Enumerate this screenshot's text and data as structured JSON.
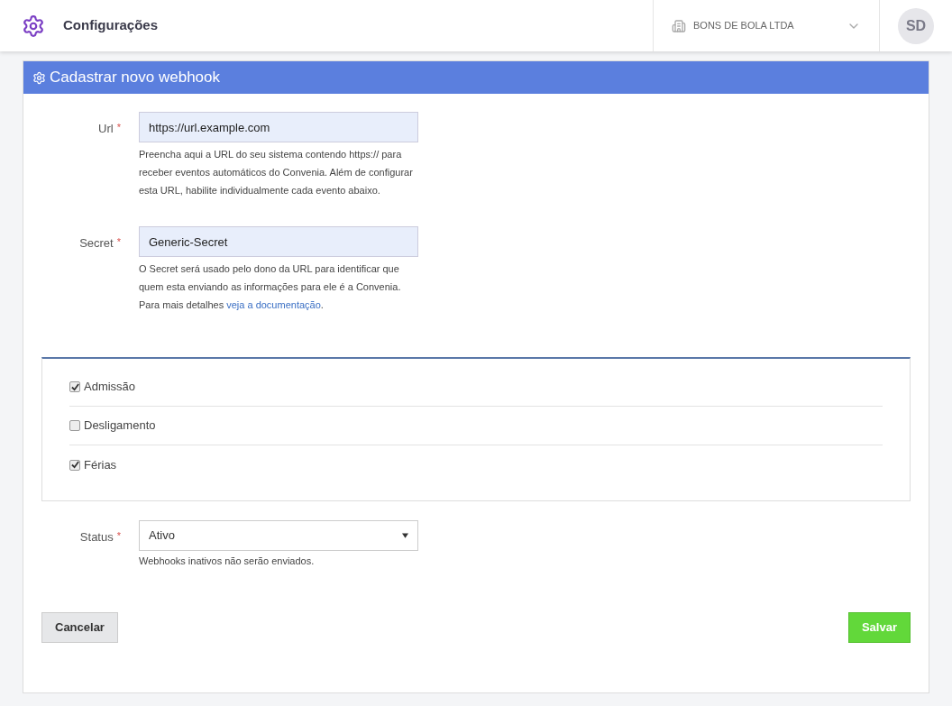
{
  "header": {
    "title": "Configurações",
    "company": "BONS DE BOLA LTDA",
    "avatar": "SD"
  },
  "card": {
    "title": "Cadastrar novo webhook",
    "fields": [
      {
        "label": "Url",
        "required_mark": "*",
        "value": "https://url.example.com",
        "help": {
          "text": "Preencha aqui a URL do seu sistema contendo https:// para receber eventos automáticos do Convenia. Além de configurar esta URL, habilite individualmente cada evento abaixo."
        }
      },
      {
        "label": "Secret",
        "required_mark": "*",
        "value": "Generic-Secret",
        "help": {
          "text": "O Secret será usado pelo dono da URL para identificar que quem esta enviando as informações para ele é a Convenia. Para mais detalhes ",
          "link": "veja a documentação",
          "after": "."
        }
      }
    ],
    "events": [
      {
        "label": "Admissão",
        "checked": true
      },
      {
        "label": "Desligamento",
        "checked": false
      },
      {
        "label": "Férias",
        "checked": true
      }
    ],
    "status": {
      "label": "Status",
      "required_mark": "*",
      "value": "Ativo",
      "help": "Webhooks inativos não serão enviados."
    },
    "buttons": {
      "cancel": "Cancelar",
      "save": "Salvar"
    }
  }
}
